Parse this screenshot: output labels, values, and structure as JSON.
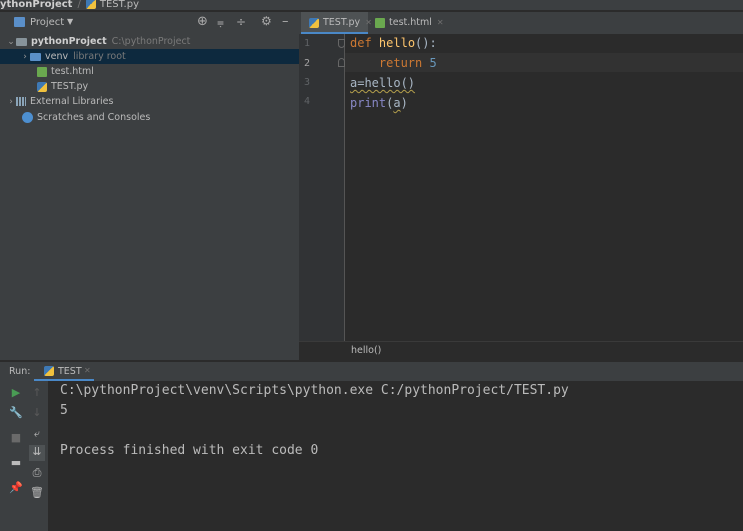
{
  "titlebar": {
    "project": "ythonProject",
    "file": "TEST.py"
  },
  "project_panel": {
    "title": "Project",
    "tree": {
      "root_label": "pythonProject",
      "root_path": "C:\\pythonProject",
      "venv_label": "venv",
      "venv_note": "library root",
      "file_html": "test.html",
      "file_py": "TEST.py",
      "external_libs": "External Libraries",
      "scratches": "Scratches and Consoles"
    }
  },
  "editor": {
    "tabs": [
      {
        "label": "TEST.py",
        "active": true
      },
      {
        "label": "test.html",
        "active": false
      }
    ],
    "line_numbers": [
      "1",
      "2",
      "3",
      "4"
    ],
    "code": {
      "l1_kw": "def",
      "l1_fn": "hello",
      "l1_rest": "():",
      "l2_kw": "return",
      "l2_num": "5",
      "l3": "a=hello()",
      "l4_fn": "print",
      "l4_open": "(",
      "l4_arg": "a",
      "l4_close": ")"
    },
    "breadcrumb": "hello()"
  },
  "run": {
    "label": "Run:",
    "tab": "TEST",
    "output": [
      "C:\\pythonProject\\venv\\Scripts\\python.exe C:/pythonProject/TEST.py",
      "5",
      "",
      "Process finished with exit code 0"
    ]
  },
  "colors": {
    "panel_bg": "#3c3f41",
    "editor_bg": "#2b2b2b",
    "selection": "#0d293e",
    "keyword": "#cc7832",
    "function": "#ffc66d",
    "number": "#6897bb",
    "run_green": "#499c54"
  }
}
